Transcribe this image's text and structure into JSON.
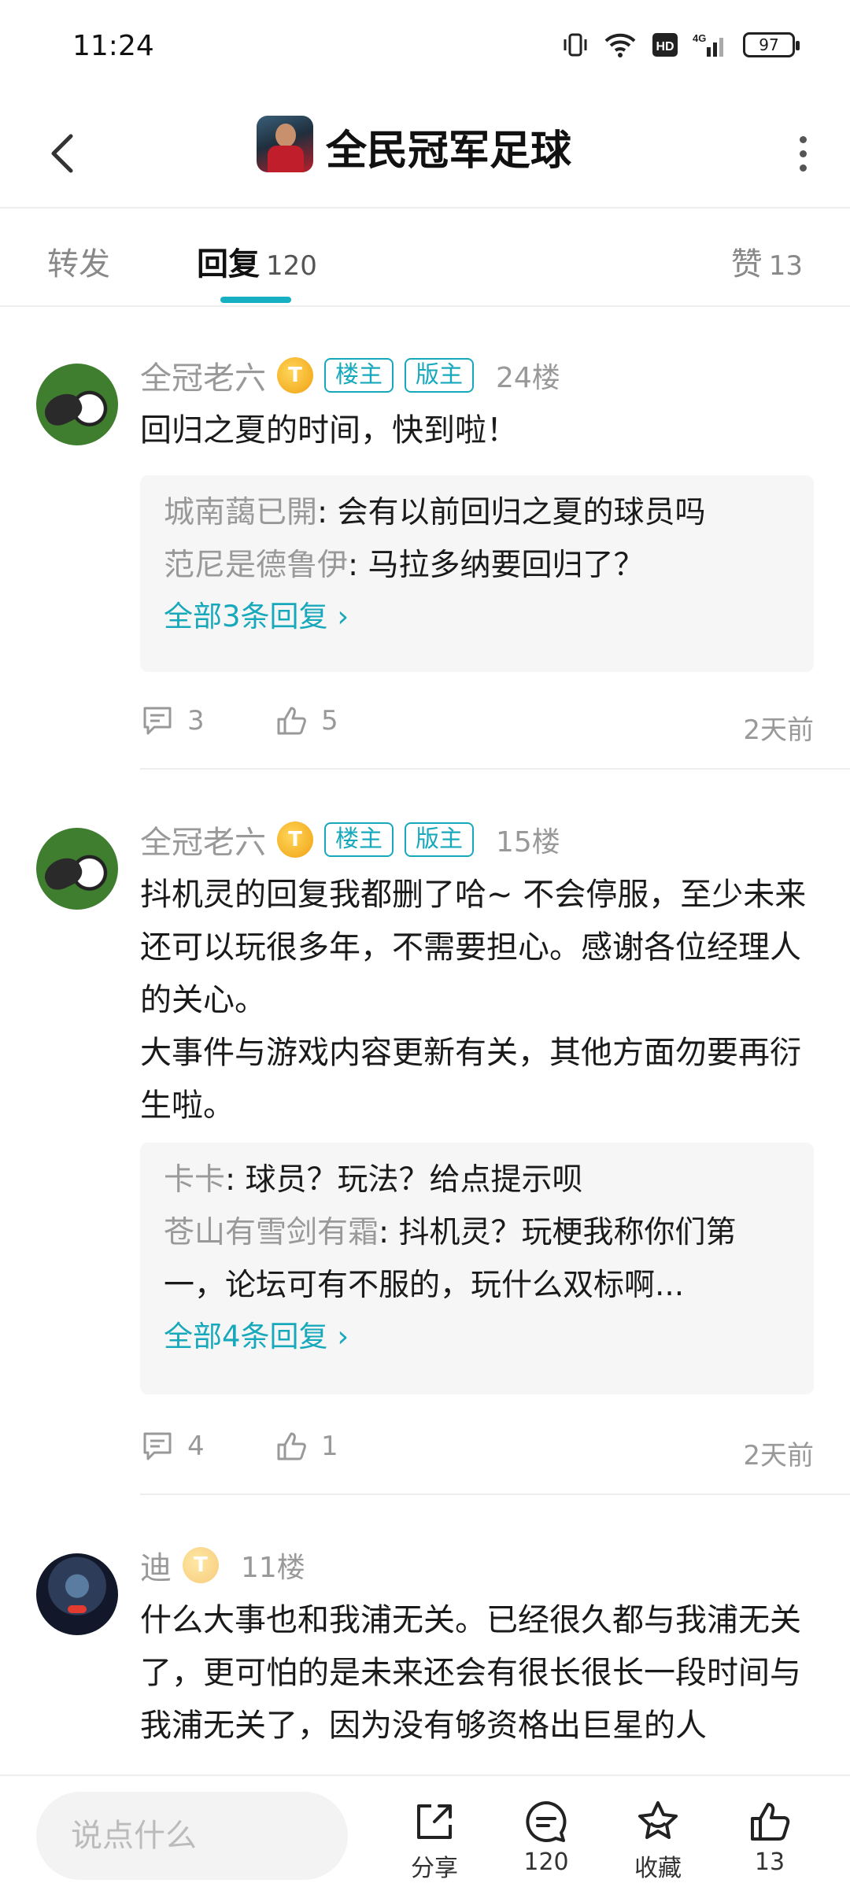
{
  "status_bar": {
    "time": "11:24",
    "battery": "97"
  },
  "header": {
    "title": "全民冠军足球"
  },
  "tabs": [
    {
      "label": "转发",
      "count": ""
    },
    {
      "label": "回复",
      "count": "120"
    },
    {
      "label": "赞",
      "count": "13"
    }
  ],
  "posts": [
    {
      "username": "全冠老六",
      "tags": [
        "楼主",
        "版主"
      ],
      "floor": "24楼",
      "lines": [
        "回归之夏的时间，快到啦！"
      ],
      "replies": [
        {
          "name": "城南藹已開",
          "text": ": 会有以前回归之夏的球员吗"
        },
        {
          "name": "范尼是德鲁伊",
          "text": ": 马拉多纳要回归了？"
        }
      ],
      "all_replies": "全部3条回复",
      "comments": "3",
      "likes": "5",
      "time": "2天前"
    },
    {
      "username": "全冠老六",
      "tags": [
        "楼主",
        "版主"
      ],
      "floor": "15楼",
      "lines": [
        "抖机灵的回复我都删了哈~ 不会停服，至少未来还可以玩很多年，不需要担心。感谢各位经理人的关心。",
        "大事件与游戏内容更新有关，其他方面勿要再衍生啦。"
      ],
      "replies": [
        {
          "name": "卡卡",
          "text": ": 球员？玩法？给点提示呗"
        },
        {
          "name": "苍山有雪剑有霜",
          "text": ": 抖机灵？玩梗我称你们第一，论坛可有不服的，玩什么双标啊..."
        }
      ],
      "all_replies": "全部4条回复",
      "comments": "4",
      "likes": "1",
      "time": "2天前"
    },
    {
      "username": "迪",
      "tags": [],
      "floor": "11楼",
      "lines": [
        "什么大事也和我浦无关。已经很久都与我浦无关了，更可怕的是未来还会有很长很长一段时间与我浦无关了，因为没有够资格出巨星的人"
      ]
    }
  ],
  "bottom_bar": {
    "input_placeholder": "说点什么",
    "share_label": "分享",
    "comment_count": "120",
    "collect_label": "收藏",
    "like_count": "13"
  },
  "colors": {
    "accent": "#17b0c2",
    "secondary_text": "#999999",
    "reply_bg": "#f6f6f6"
  },
  "icons": [
    "back-icon",
    "more-icon",
    "comment-icon",
    "thumb-up-icon",
    "share-icon",
    "star-icon"
  ]
}
